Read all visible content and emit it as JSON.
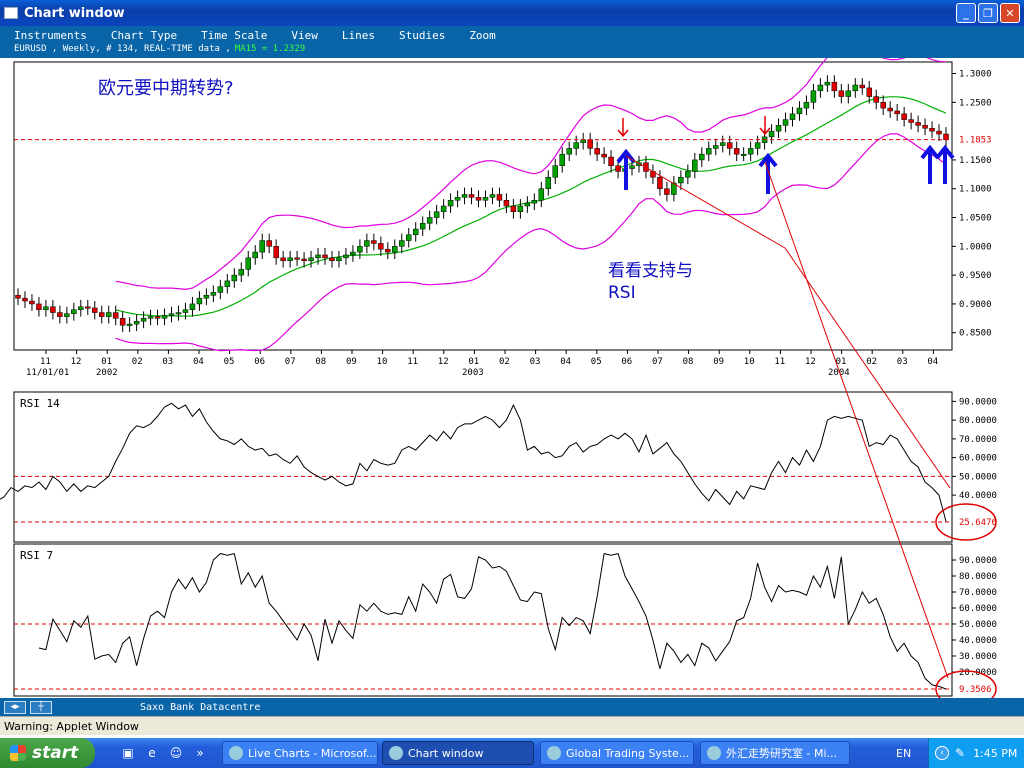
{
  "window": {
    "title": "Chart window"
  },
  "menu": [
    "Instruments",
    "Chart Type",
    "Time Scale",
    "View",
    "Lines",
    "Studies",
    "Zoom"
  ],
  "info": {
    "left": "EURUSD , Weekly, # 134, REAL-TIME data ,",
    "ma": "MA15 = 1.2329"
  },
  "annotations": {
    "title": "欧元要中期转势?",
    "note1": "看看支持与",
    "note2": "RSI"
  },
  "colors": {
    "window_blue": "#0a64a8",
    "bollinger": "#e000e0",
    "ma": "#00b000",
    "candle_up": "#00a000",
    "candle_down": "#e00000",
    "annotation_red": "#e00000",
    "arrow_blue": "#1010e0"
  },
  "chart_data": [
    {
      "type": "candlestick",
      "name_label": "EURUSD",
      "ylim": [
        0.82,
        1.32
      ],
      "y_ticks": [
        "1.3000",
        "1.2500",
        "1.1500",
        "1.1000",
        "1.0500",
        "1.0000",
        "0.9500",
        "0.9000",
        "0.8500"
      ],
      "current_label": "1.1853",
      "x_ticks": [
        "11",
        "12",
        "01",
        "02",
        "03",
        "04",
        "05",
        "06",
        "07",
        "08",
        "09",
        "10",
        "11",
        "12",
        "01",
        "02",
        "03",
        "04",
        "05",
        "06",
        "07",
        "08",
        "09",
        "10",
        "11",
        "12",
        "01",
        "02",
        "03",
        "04"
      ],
      "x_sublabels": [
        "11/01/01",
        "2002",
        "2003",
        "2004"
      ],
      "close": [
        0.91,
        0.905,
        0.9,
        0.89,
        0.895,
        0.885,
        0.878,
        0.883,
        0.89,
        0.895,
        0.893,
        0.885,
        0.878,
        0.885,
        0.875,
        0.863,
        0.865,
        0.87,
        0.875,
        0.878,
        0.875,
        0.88,
        0.883,
        0.885,
        0.89,
        0.9,
        0.91,
        0.915,
        0.92,
        0.93,
        0.94,
        0.95,
        0.96,
        0.98,
        0.99,
        1.01,
        1.0,
        0.98,
        0.975,
        0.98,
        0.978,
        0.975,
        0.98,
        0.985,
        0.98,
        0.975,
        0.98,
        0.985,
        0.99,
        1.0,
        1.01,
        1.005,
        0.995,
        0.99,
        1.0,
        1.01,
        1.02,
        1.03,
        1.04,
        1.05,
        1.06,
        1.07,
        1.08,
        1.085,
        1.09,
        1.085,
        1.08,
        1.085,
        1.09,
        1.08,
        1.07,
        1.06,
        1.07,
        1.075,
        1.08,
        1.1,
        1.12,
        1.14,
        1.16,
        1.17,
        1.18,
        1.185,
        1.17,
        1.16,
        1.155,
        1.14,
        1.13,
        1.135,
        1.14,
        1.145,
        1.13,
        1.12,
        1.1,
        1.09,
        1.11,
        1.12,
        1.13,
        1.15,
        1.16,
        1.17,
        1.175,
        1.18,
        1.17,
        1.16,
        1.16,
        1.17,
        1.18,
        1.19,
        1.2,
        1.21,
        1.22,
        1.23,
        1.24,
        1.25,
        1.27,
        1.28,
        1.285,
        1.27,
        1.26,
        1.27,
        1.28,
        1.275,
        1.26,
        1.25,
        1.24,
        1.235,
        1.23,
        1.22,
        1.215,
        1.21,
        1.205,
        1.2,
        1.195,
        1.185
      ],
      "ma15_label": "MA15 = 1.2329"
    },
    {
      "type": "line",
      "title": "RSI 14",
      "ylim": [
        15,
        95
      ],
      "y_ticks": [
        "90.0000",
        "80.0000",
        "70.0000",
        "60.0000",
        "50.0000",
        "40.0000"
      ],
      "current_label": "25.6476",
      "reference_lines": [
        50,
        25.65
      ],
      "values": [
        39,
        37,
        39,
        44,
        42,
        45,
        44,
        47,
        43,
        50,
        47,
        42,
        46,
        42,
        45,
        44,
        47,
        50,
        58,
        65,
        73,
        77,
        76,
        78,
        82,
        87,
        89,
        86,
        88,
        82,
        86,
        79,
        74,
        70,
        69,
        67,
        70,
        66,
        64,
        65,
        61,
        62,
        59,
        57,
        61,
        55,
        52,
        50,
        48,
        50,
        47,
        45,
        46,
        57,
        53,
        59,
        57,
        56,
        57,
        64,
        66,
        64,
        68,
        72,
        69,
        74,
        70,
        76,
        78,
        78,
        80,
        82,
        80,
        76,
        80,
        88,
        80,
        64,
        66,
        62,
        63,
        60,
        61,
        66,
        68,
        63,
        66,
        67,
        70,
        72,
        70,
        73,
        70,
        63,
        72,
        62,
        65,
        68,
        62,
        58,
        52,
        46,
        41,
        37,
        43,
        39,
        35,
        42,
        38,
        45,
        44,
        43,
        52,
        58,
        52,
        60,
        56,
        64,
        58,
        66,
        80,
        82,
        81,
        82,
        81,
        80,
        66,
        68,
        67,
        72,
        70,
        64,
        58,
        55,
        47,
        44,
        40,
        26
      ]
    },
    {
      "type": "line",
      "title": "RSI 7",
      "ylim": [
        5,
        100
      ],
      "y_ticks": [
        "90.0000",
        "80.0000",
        "70.0000",
        "60.0000",
        "50.0000",
        "40.0000",
        "30.0000",
        "20.0000"
      ],
      "current_label": "9.3506",
      "reference_lines": [
        50,
        9.35
      ],
      "values": [
        35,
        34,
        53,
        46,
        39,
        52,
        48,
        55,
        28,
        30,
        31,
        26,
        38,
        42,
        24,
        41,
        55,
        58,
        54,
        70,
        78,
        72,
        79,
        70,
        76,
        90,
        94,
        93,
        94,
        75,
        82,
        73,
        80,
        63,
        58,
        52,
        46,
        40,
        50,
        43,
        27,
        53,
        38,
        52,
        46,
        41,
        62,
        58,
        63,
        58,
        56,
        57,
        56,
        67,
        58,
        75,
        70,
        63,
        78,
        81,
        67,
        66,
        72,
        92,
        90,
        85,
        86,
        83,
        74,
        65,
        64,
        70,
        69,
        47,
        34,
        54,
        49,
        54,
        52,
        44,
        67,
        94,
        93,
        94,
        80,
        72,
        64,
        55,
        40,
        22,
        38,
        33,
        26,
        31,
        24,
        38,
        35,
        27,
        33,
        39,
        52,
        54,
        66,
        88,
        73,
        64,
        74,
        70,
        71,
        70,
        68,
        80,
        73,
        86,
        66,
        92,
        50,
        59,
        70,
        63,
        66,
        56,
        42,
        33,
        38,
        30,
        26,
        16,
        12,
        11,
        9.4
      ]
    }
  ],
  "statusbar": {
    "text": "Saxo Bank Datacentre",
    "warning": "Warning: Applet Window"
  },
  "taskbar": {
    "start": "start",
    "tasks": [
      "Live Charts - Microsof...",
      "Chart window",
      "Global Trading Syste...",
      "外汇走势研究室 - Mi..."
    ],
    "lang": "EN",
    "time": "1:45 PM"
  }
}
